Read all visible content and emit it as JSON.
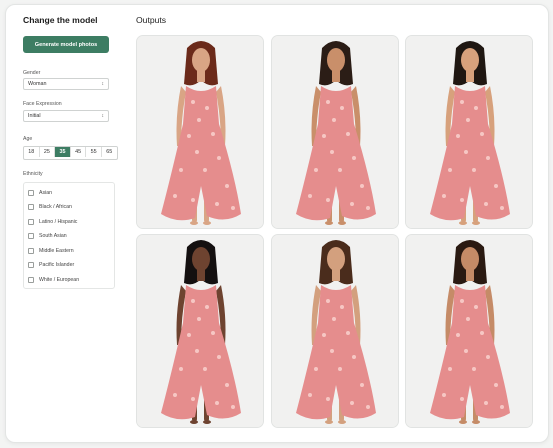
{
  "sidebar": {
    "title": "Change the model",
    "generate_label": "Generate model photos",
    "gender": {
      "label": "Gender",
      "value": "Woman"
    },
    "face_expression": {
      "label": "Face Expression",
      "value": "Initial"
    },
    "age": {
      "label": "Age",
      "options": [
        "18",
        "25",
        "35",
        "45",
        "55",
        "65"
      ],
      "selected": "35"
    },
    "ethnicity": {
      "label": "Ethnicity",
      "options": [
        "Asian",
        "Black / African",
        "Latino / Hispanic",
        "South Asian",
        "Middle Eastern",
        "Pacific Islander",
        "White / European"
      ]
    }
  },
  "outputs": {
    "title": "Outputs",
    "photos": [
      {
        "hair": "#6b2a1a",
        "skin": "#d9a585"
      },
      {
        "hair": "#2b1d16",
        "skin": "#c98f6a"
      },
      {
        "hair": "#1f1712",
        "skin": "#d7a17c"
      },
      {
        "hair": "#141010",
        "skin": "#6e4330"
      },
      {
        "hair": "#4a2c1c",
        "skin": "#d3a07e"
      },
      {
        "hair": "#2a1a12",
        "skin": "#c58b67"
      }
    ]
  },
  "colors": {
    "accent": "#3d7d63",
    "dress": "#e58d8d",
    "dress_pattern": "#f6c7c4",
    "photo_bg": "#f1f1f0"
  },
  "icons": {
    "select_chevron": "chevron-updown-icon"
  }
}
